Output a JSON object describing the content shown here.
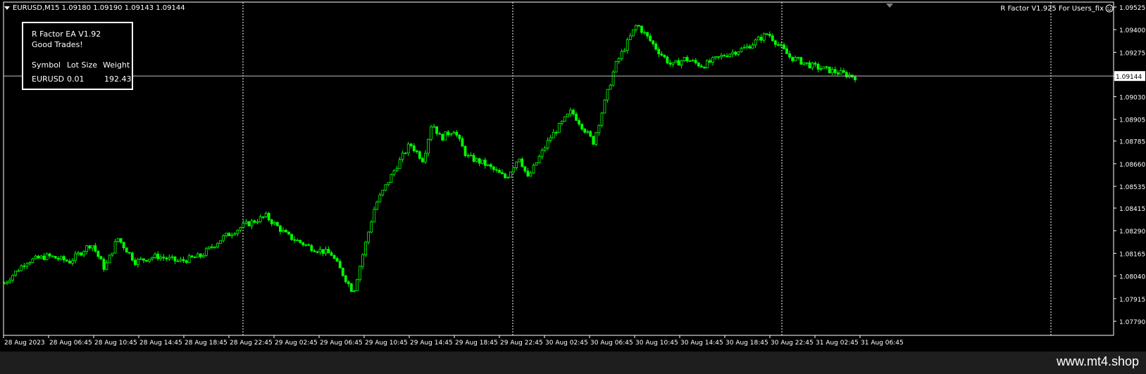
{
  "header": {
    "symbol_line": "EURUSD,M15  1.09180 1.09190 1.09143 1.09144",
    "ea_tag": "R Factor V1.925 For Users_fix",
    "smiley_icon": "smiley-icon"
  },
  "info_panel": {
    "ea_name": "R Factor EA V1.92",
    "message": "Good Trades!",
    "columns": [
      "Symbol",
      "Lot Size",
      "Weight"
    ],
    "row": [
      "EURUSD",
      "0.01",
      "192.43"
    ]
  },
  "footer": {
    "url": "www.mt4.shop"
  },
  "colors": {
    "background": "#000000",
    "candle": "#00ff00",
    "grid_line": "#ffffff",
    "footer_bg": "#1e1e1e"
  },
  "chart_data": {
    "type": "line",
    "title": "EURUSD,M15",
    "xlabel": "",
    "ylabel": "",
    "ylim": [
      1.0779,
      1.09525
    ],
    "yticks": [
      1.09525,
      1.094,
      1.09275,
      1.09144,
      1.0903,
      1.08905,
      1.08785,
      1.0866,
      1.08535,
      1.08415,
      1.0829,
      1.08165,
      1.0804,
      1.07915,
      1.0779
    ],
    "current_price": 1.09144,
    "xticks": [
      "28 Aug 2023",
      "28 Aug 06:45",
      "28 Aug 10:45",
      "28 Aug 14:45",
      "28 Aug 18:45",
      "28 Aug 22:45",
      "29 Aug 02:45",
      "29 Aug 06:45",
      "29 Aug 10:45",
      "29 Aug 14:45",
      "29 Aug 18:45",
      "29 Aug 22:45",
      "30 Aug 02:45",
      "30 Aug 06:45",
      "30 Aug 10:45",
      "30 Aug 14:45",
      "30 Aug 18:45",
      "30 Aug 22:45",
      "31 Aug 02:45",
      "31 Aug 06:45"
    ],
    "day_separators": [
      "29 Aug",
      "30 Aug",
      "31 Aug",
      "01 Sep"
    ],
    "grid": false,
    "series": [
      {
        "name": "",
        "x": [
          0,
          0.5,
          1,
          1.5,
          2,
          2.3,
          2.6,
          3,
          3.5,
          4,
          4.5,
          5,
          5.5,
          6,
          6.5,
          7,
          7.5,
          8,
          8.5,
          9,
          9.3,
          9.6,
          9.8,
          10,
          10.3,
          10.6,
          11,
          11.5,
          11.8,
          12,
          12.5,
          13,
          13.5,
          14,
          14.5,
          15,
          15.3,
          15.6,
          16,
          16.5,
          17,
          17.5,
          18,
          18.5,
          19,
          19.5
        ],
        "y": [
          1.08,
          1.0812,
          1.0815,
          1.0812,
          1.0822,
          1.0808,
          1.0825,
          1.0812,
          1.0815,
          1.0812,
          1.0815,
          1.0825,
          1.0832,
          1.0837,
          1.0826,
          1.082,
          1.0816,
          1.0795,
          1.0843,
          1.0865,
          1.0877,
          1.0868,
          1.0889,
          1.088,
          1.0885,
          1.087,
          1.0866,
          1.0858,
          1.087,
          1.0858,
          1.088,
          1.0895,
          1.0878,
          1.092,
          1.0943,
          1.0928,
          1.092,
          1.0924,
          1.092,
          1.0926,
          1.093,
          1.0938,
          1.0925,
          1.092,
          1.0917,
          1.0914
        ]
      }
    ]
  }
}
